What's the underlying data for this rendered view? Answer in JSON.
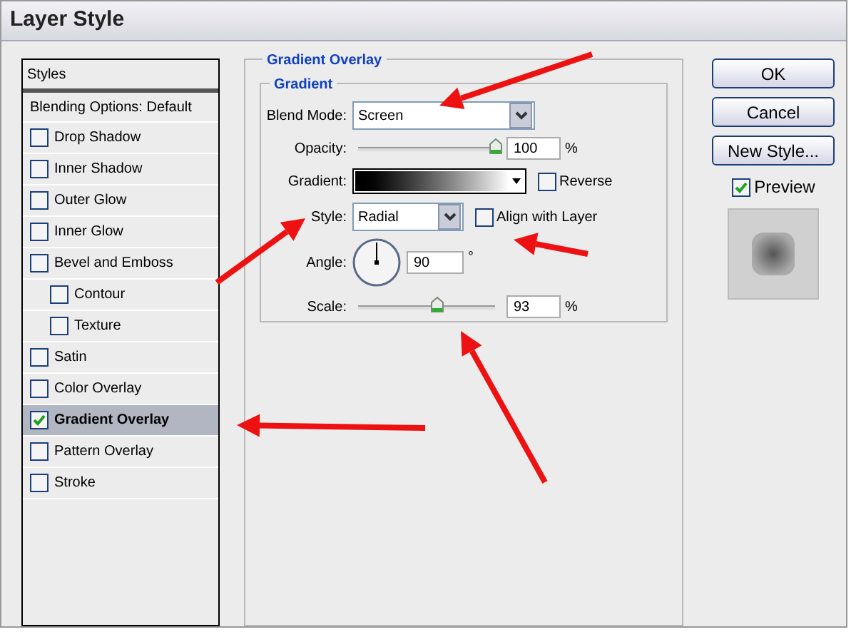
{
  "window": {
    "title": "Layer Style"
  },
  "styles_list": {
    "header": "Styles",
    "items": [
      {
        "label": "Blending Options: Default",
        "kind": "plain",
        "selected": false
      },
      {
        "label": "Drop Shadow",
        "kind": "option",
        "checked": false,
        "selected": false
      },
      {
        "label": "Inner Shadow",
        "kind": "option",
        "checked": false,
        "selected": false
      },
      {
        "label": "Outer Glow",
        "kind": "option",
        "checked": false,
        "selected": false
      },
      {
        "label": "Inner Glow",
        "kind": "option",
        "checked": false,
        "selected": false
      },
      {
        "label": "Bevel and Emboss",
        "kind": "option",
        "checked": false,
        "selected": false,
        "children": [
          {
            "label": "Contour",
            "kind": "option",
            "checked": false,
            "selected": false
          },
          {
            "label": "Texture",
            "kind": "option",
            "checked": false,
            "selected": false
          }
        ]
      },
      {
        "label": "Satin",
        "kind": "option",
        "checked": false,
        "selected": false
      },
      {
        "label": "Color Overlay",
        "kind": "option",
        "checked": false,
        "selected": false
      },
      {
        "label": "Gradient Overlay",
        "kind": "option",
        "checked": true,
        "selected": true
      },
      {
        "label": "Pattern Overlay",
        "kind": "option",
        "checked": false,
        "selected": false
      },
      {
        "label": "Stroke",
        "kind": "option",
        "checked": false,
        "selected": false
      }
    ]
  },
  "panel": {
    "title": "Gradient Overlay",
    "group": "Gradient",
    "blend_mode": {
      "label": "Blend Mode:",
      "value": "Screen"
    },
    "opacity": {
      "label": "Opacity:",
      "level": 1.0,
      "value": "100",
      "unit": "%"
    },
    "gradient": {
      "label": "Gradient:"
    },
    "reverse": {
      "label": "Reverse",
      "checked": false
    },
    "style": {
      "label": "Style:",
      "value": "Radial"
    },
    "align_with_layer": {
      "label": "Align with Layer",
      "checked": false
    },
    "angle": {
      "label": "Angle:",
      "value": "90",
      "unit": "°"
    },
    "scale": {
      "label": "Scale:",
      "level": 0.57,
      "value": "93",
      "unit": "%"
    }
  },
  "buttons": [
    "OK",
    "Cancel",
    "New Style..."
  ],
  "preview": {
    "label": "Preview",
    "checked": true
  }
}
